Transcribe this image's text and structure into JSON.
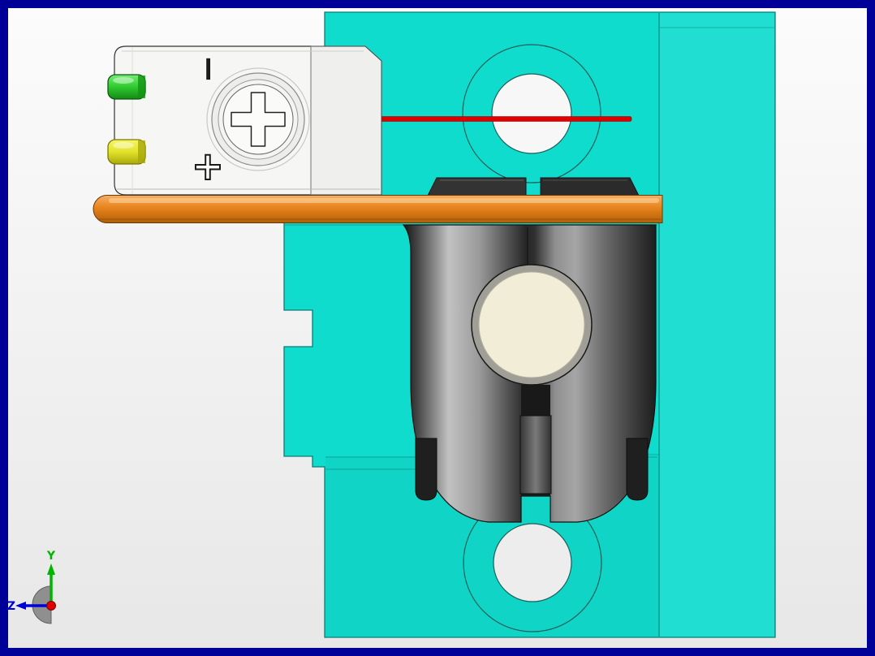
{
  "viewport": {
    "background_top": "#FCFCFC",
    "background_bottom": "#E7E7E7",
    "border_color": "#000099"
  },
  "colors": {
    "part_cyan": "#10DCCE",
    "part_cyan_edge": "#0A7E76",
    "plate_orange": "#E8831C",
    "plate_orange_light": "#F7B068",
    "plate_orange_dark": "#B05E07",
    "axis_red_line": "#DF0000",
    "connector_green": "#2FCB2F",
    "connector_yellow": "#E3E32B",
    "clevis_gray": "#3A3A3A",
    "bushing_cream": "#F1EDD6",
    "body_white": "#F6F6F4",
    "triad_y_green": "#00B400",
    "triad_z_blue": "#0000D8",
    "triad_x_red": "#E00000"
  },
  "markings": {
    "terminal_minus": "−",
    "terminal_plus": "+"
  },
  "triad": {
    "y_label": "Y",
    "z_label": "Z"
  }
}
